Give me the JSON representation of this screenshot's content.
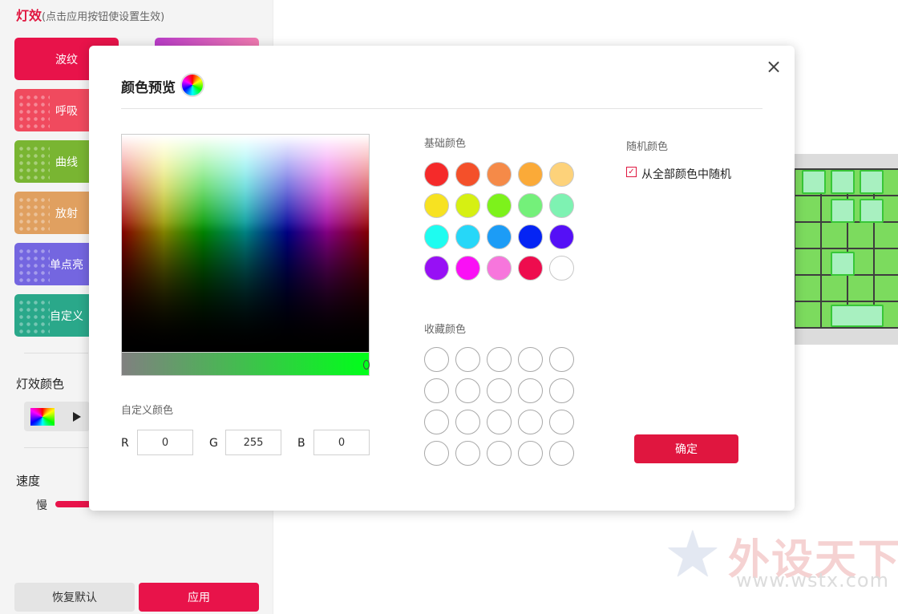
{
  "sidebar": {
    "title": "灯效",
    "title_hint": "(点击应用按钮使设置生效)",
    "effects": [
      {
        "label": "波纹",
        "color": "#e8134a"
      },
      {
        "label": "",
        "color": "#d05ad0"
      },
      {
        "label": "呼吸",
        "color": "#f04a5e"
      },
      {
        "label": "曲线",
        "color": "#79b532"
      },
      {
        "label": "放射",
        "color": "#e0a060"
      },
      {
        "label": "单点亮",
        "color": "#7466e0"
      },
      {
        "label": "自定义",
        "color": "#2aa88a"
      }
    ],
    "color_section_label": "灯效颜色",
    "speed_label": "速度",
    "speed_slow_label": "慢",
    "reset_label": "恢复默认",
    "apply_label": "应用"
  },
  "dialog": {
    "title": "颜色预览",
    "close_glyph": "×",
    "custom_color_label": "自定义颜色",
    "rgb": {
      "r_label": "R",
      "g_label": "G",
      "b_label": "B",
      "r": "0",
      "g": "255",
      "b": "0"
    },
    "basic_colors_label": "基础颜色",
    "basic_colors": [
      "#f52a2a",
      "#f4502a",
      "#f58a48",
      "#fbaa38",
      "#fdd27a",
      "#f7e221",
      "#d6f012",
      "#7df21b",
      "#74f07a",
      "#7ef2b2",
      "#1efcf0",
      "#26d7f8",
      "#1c9cf6",
      "#0524f4",
      "#5510f6",
      "#9710f5",
      "#fa10f5",
      "#f776dc",
      "#ee0c4e",
      "#ffffff"
    ],
    "favorite_colors_label": "收藏颜色",
    "random_color_label": "随机颜色",
    "random_all_label": "从全部颜色中随机",
    "random_checked": true,
    "confirm_label": "确定"
  },
  "watermark": {
    "text": "外设天下",
    "url": "www.wstx.com"
  }
}
